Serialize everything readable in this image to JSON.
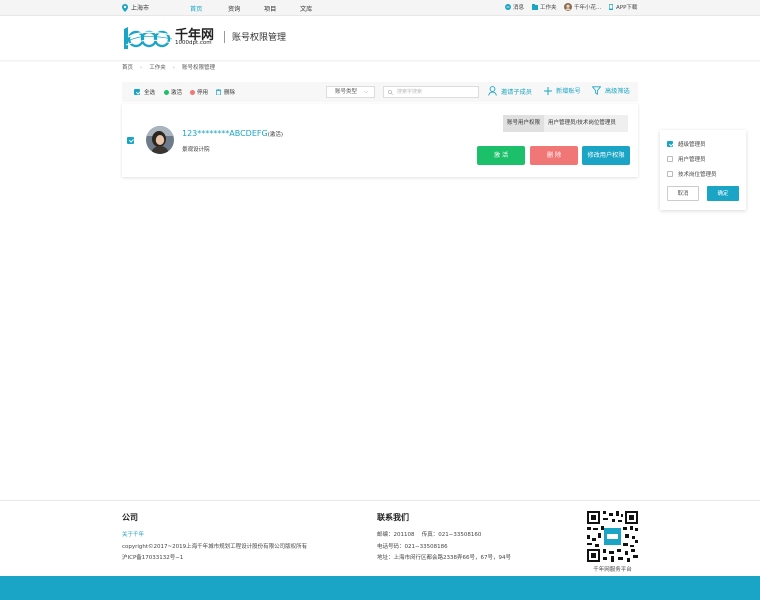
{
  "topbar": {
    "city": "上海市",
    "nav": [
      "首页",
      "资询",
      "项目",
      "文库"
    ],
    "messages": "消息",
    "workspace": "工作夹",
    "user": "千年小花...",
    "app": "APP下载"
  },
  "header": {
    "logo_cn": "千年网",
    "logo_en": "1000dpt.com",
    "title": "账号权限管理"
  },
  "breadcrumb": [
    "首页",
    "工作夹",
    "账号权限管理"
  ],
  "toolbar": {
    "select_all": "全选",
    "activate": "激活",
    "disable": "停用",
    "delete": "删除",
    "type_select": "账号类型",
    "search_placeholder": "搜索字搜索",
    "invite": "邀请子成员",
    "add_account": "新增账号",
    "advanced_filter": "高级筛选"
  },
  "account": {
    "name": "123********ABCDEFG",
    "status": "(激活)",
    "company": "景观设计院",
    "perm_label": "账号用户权限",
    "perm_value": "用户管理员/技术岗位管理员",
    "btn_activate": "激 活",
    "btn_delete": "删 除",
    "btn_modify": "修改用户权限"
  },
  "popup": {
    "options": [
      "超级管理员",
      "用户管理员",
      "技术岗位管理员"
    ],
    "checked": [
      true,
      false,
      false
    ],
    "cancel": "取消",
    "confirm": "确定"
  },
  "footer": {
    "company_title": "公司",
    "about": "关于千年",
    "copyright": "copyright©2017~2019上海千年城市规划工程设计股份有限公司版权所有",
    "icp": "沪ICP备17033132号−1",
    "contact_title": "联系我们",
    "postal": "邮编：201108　 传真：021−33508160",
    "phone": "电话号码：021−33508186",
    "address": "地址：上海市闵行区都会路2338弄66号，67号，94号",
    "qr_caption": "千年网服务平台"
  },
  "colors": {
    "accent": "#1aa5c6",
    "green": "#1cc06a",
    "red": "#f07775",
    "nav_active": "#1aa5c6"
  }
}
